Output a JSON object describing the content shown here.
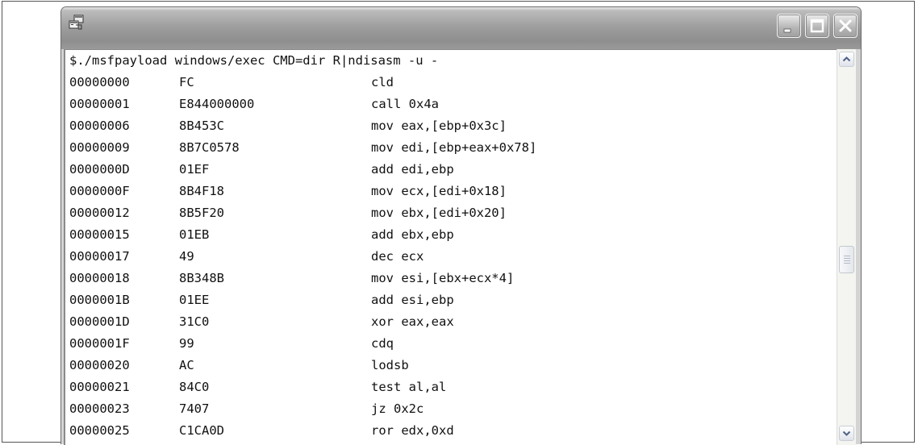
{
  "window": {
    "icon": "console-window-icon",
    "controls": {
      "minimize_icon": "minimize-icon",
      "maximize_icon": "maximize-icon",
      "close_icon": "close-icon"
    }
  },
  "console": {
    "command": "$./msfpayload windows/exec CMD=dir R|ndisasm -u -",
    "rows": [
      {
        "addr": "00000000",
        "hex": "FC",
        "instr": "cld"
      },
      {
        "addr": "00000001",
        "hex": "E844000000",
        "instr": "call 0x4a"
      },
      {
        "addr": "00000006",
        "hex": "8B453C",
        "instr": "mov eax,[ebp+0x3c]"
      },
      {
        "addr": "00000009",
        "hex": "8B7C0578",
        "instr": "mov edi,[ebp+eax+0x78]"
      },
      {
        "addr": "0000000D",
        "hex": "01EF",
        "instr": "add edi,ebp"
      },
      {
        "addr": "0000000F",
        "hex": "8B4F18",
        "instr": "mov ecx,[edi+0x18]"
      },
      {
        "addr": "00000012",
        "hex": "8B5F20",
        "instr": "mov ebx,[edi+0x20]"
      },
      {
        "addr": "00000015",
        "hex": "01EB",
        "instr": "add ebx,ebp"
      },
      {
        "addr": "00000017",
        "hex": "49",
        "instr": "dec ecx"
      },
      {
        "addr": "00000018",
        "hex": "8B348B",
        "instr": "mov esi,[ebx+ecx*4]"
      },
      {
        "addr": "0000001B",
        "hex": "01EE",
        "instr": "add esi,ebp"
      },
      {
        "addr": "0000001D",
        "hex": "31C0",
        "instr": "xor eax,eax"
      },
      {
        "addr": "0000001F",
        "hex": "99",
        "instr": "cdq"
      },
      {
        "addr": "00000020",
        "hex": "AC",
        "instr": "lodsb"
      },
      {
        "addr": "00000021",
        "hex": "84C0",
        "instr": "test al,al"
      },
      {
        "addr": "00000023",
        "hex": "7407",
        "instr": "jz 0x2c"
      },
      {
        "addr": "00000025",
        "hex": "C1CA0D",
        "instr": "ror edx,0xd"
      }
    ]
  },
  "scrollbar": {
    "up_icon": "scroll-up-arrow-icon",
    "down_icon": "scroll-down-arrow-icon",
    "thumb_icon": "scroll-thumb-grip-icon",
    "position_fraction": 0.52
  },
  "colors": {
    "titlebar": "#9f9f9f",
    "console_bg": "#ffffff",
    "text": "#111111"
  }
}
